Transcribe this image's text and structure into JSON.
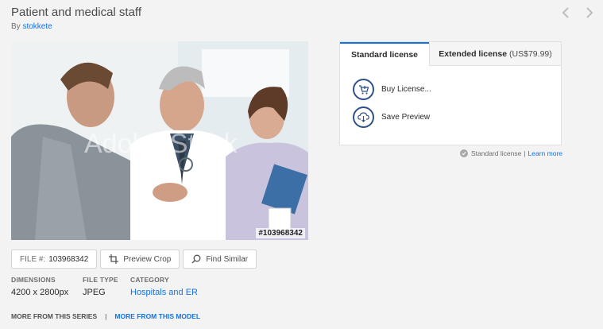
{
  "header": {
    "title": "Patient and medical staff",
    "by_prefix": "By",
    "author": "stokkete"
  },
  "image": {
    "watermark": "Adobe Stock",
    "file_overlay": "#103968342"
  },
  "actions": {
    "file_label": "FILE #:",
    "file_number": "103968342",
    "preview_crop": "Preview Crop",
    "find_similar": "Find Similar"
  },
  "meta": {
    "dimensions_label": "DIMENSIONS",
    "dimensions_value": "4200 x 2800px",
    "filetype_label": "FILE TYPE",
    "filetype_value": "JPEG",
    "category_label": "CATEGORY",
    "category_value": "Hospitals and ER"
  },
  "more": {
    "series": "MORE FROM THIS SERIES",
    "separator": "|",
    "model": "MORE FROM THIS MODEL"
  },
  "license": {
    "tab_standard": "Standard license",
    "tab_extended": "Extended license",
    "extended_price": "(US$79.99)",
    "buy": "Buy License...",
    "save_preview": "Save Preview",
    "note": "Standard license",
    "note_separator": "|",
    "learn_more": "Learn more"
  },
  "icons": {
    "prev": "chevron-left-icon",
    "next": "chevron-right-icon",
    "crop": "crop-icon",
    "search": "search-icon",
    "cart": "cart-icon",
    "cloud": "cloud-download-icon",
    "check": "check-icon"
  },
  "colors": {
    "accent": "#1473e6",
    "icon_ring": "#2d4f8c",
    "background": "#f3f3f3"
  }
}
